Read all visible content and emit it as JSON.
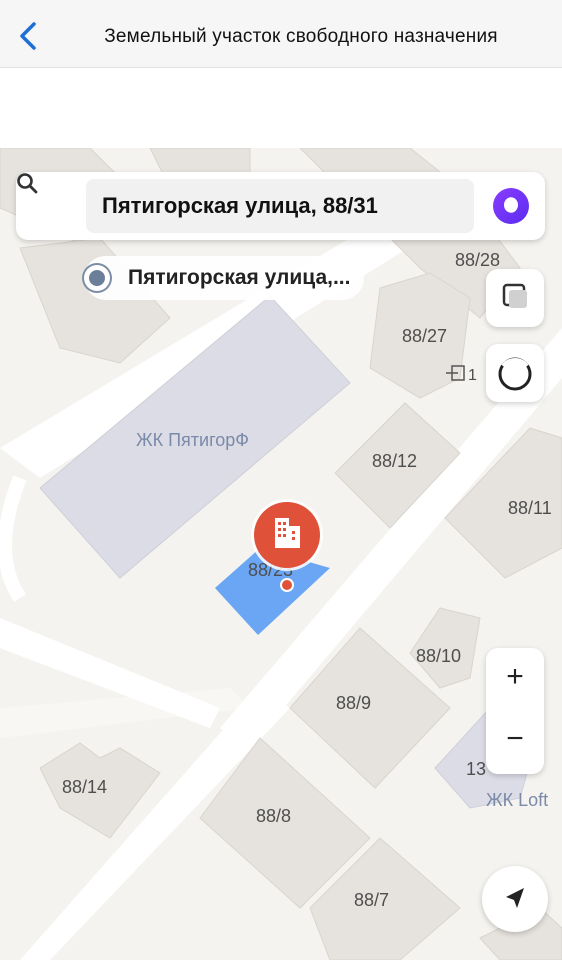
{
  "header": {
    "title": "Земельный участок свободного назначения"
  },
  "map": {
    "search": {
      "query": "Пятигорская улица, 88/31"
    },
    "address_tag": "Пятигорская улица,...",
    "complex_label": "ЖК ПятигорФ",
    "other_complex_label": "ЖК Loft",
    "entrance_number": "1",
    "buildings": {
      "b88_28": "88/28",
      "b88_27": "88/27",
      "b88_12": "88/12",
      "b88_11": "88/11",
      "b88_23": "88/23",
      "b88_10": "88/10",
      "b88_9": "88/9",
      "b88_14": "88/14",
      "b88_8": "88/8",
      "b88_7": "88/7",
      "b13": "13"
    },
    "zoom_in": "+",
    "zoom_out": "−",
    "colors": {
      "selected_plot": "#6aa6f3",
      "pin": "#e0513a",
      "alice": "#7a35f5"
    },
    "icons": [
      "back-chevron-icon",
      "search-icon",
      "alice-icon",
      "layers-icon",
      "compass-icon",
      "building-icon",
      "entrance-icon",
      "locate-arrow-icon"
    ]
  }
}
